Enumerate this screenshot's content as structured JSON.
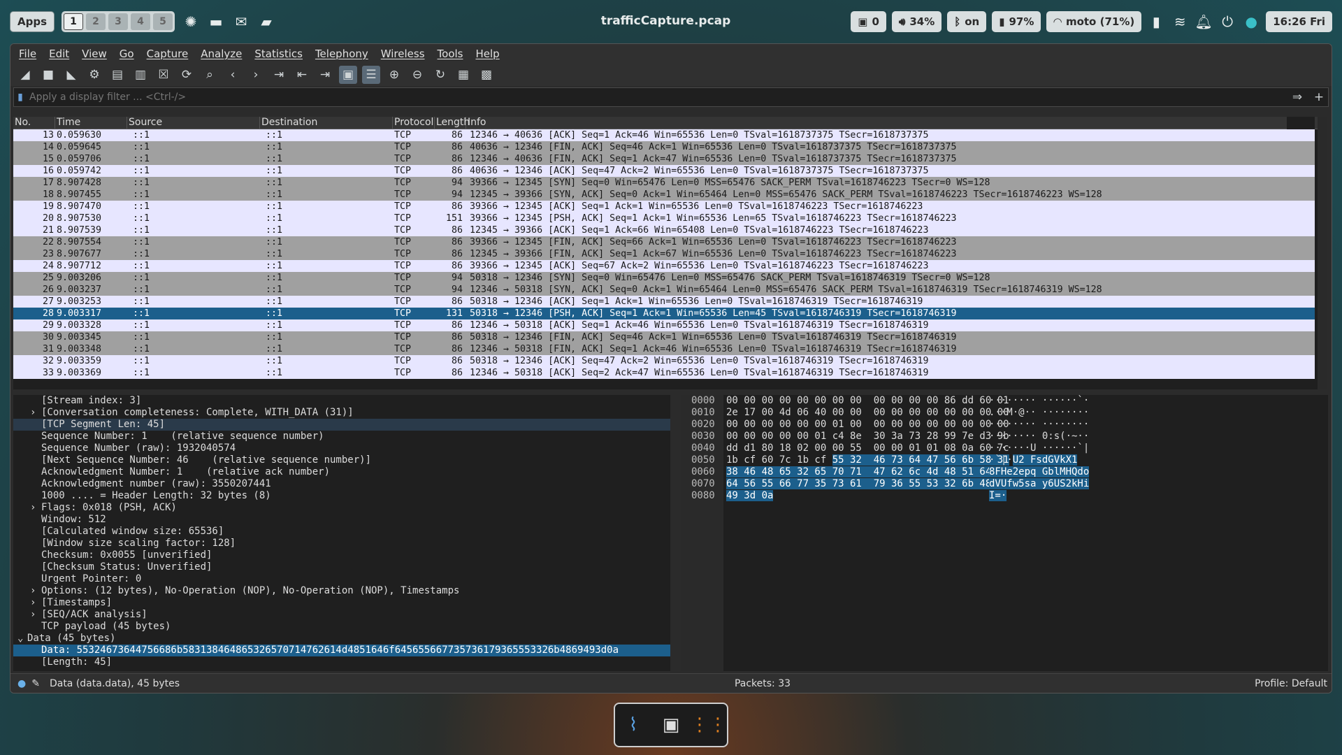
{
  "topbar": {
    "apps_label": "Apps",
    "workspaces": [
      "1",
      "2",
      "3",
      "4",
      "5"
    ],
    "window_title": "trafficCapture.pcap",
    "tray": {
      "docker": "0",
      "volume": "34%",
      "bluetooth": "on",
      "battery": "97%",
      "wifi": "moto (71%)",
      "clock": "16:26 Fri"
    }
  },
  "menu": [
    "File",
    "Edit",
    "View",
    "Go",
    "Capture",
    "Analyze",
    "Statistics",
    "Telephony",
    "Wireless",
    "Tools",
    "Help"
  ],
  "filter": {
    "placeholder": "Apply a display filter ... <Ctrl-/>"
  },
  "columns": [
    "No.",
    "Time",
    "Source",
    "Destination",
    "Protocol",
    "Length",
    "Info"
  ],
  "packets": [
    {
      "no": "13",
      "time": "0.059630",
      "src": "::1",
      "dst": "::1",
      "proto": "TCP",
      "len": "86",
      "info": "12346 → 40636 [ACK] Seq=1 Ack=46 Win=65536 Len=0 TSval=1618737375 TSecr=1618737375",
      "style": "ack"
    },
    {
      "no": "14",
      "time": "0.059645",
      "src": "::1",
      "dst": "::1",
      "proto": "TCP",
      "len": "86",
      "info": "40636 → 12346 [FIN, ACK] Seq=46 Ack=1 Win=65536 Len=0 TSval=1618737375 TSecr=1618737375",
      "style": "fin"
    },
    {
      "no": "15",
      "time": "0.059706",
      "src": "::1",
      "dst": "::1",
      "proto": "TCP",
      "len": "86",
      "info": "12346 → 40636 [FIN, ACK] Seq=1 Ack=47 Win=65536 Len=0 TSval=1618737375 TSecr=1618737375",
      "style": "fin"
    },
    {
      "no": "16",
      "time": "0.059742",
      "src": "::1",
      "dst": "::1",
      "proto": "TCP",
      "len": "86",
      "info": "40636 → 12346 [ACK] Seq=47 Ack=2 Win=65536 Len=0 TSval=1618737375 TSecr=1618737375",
      "style": "ack"
    },
    {
      "no": "17",
      "time": "8.907428",
      "src": "::1",
      "dst": "::1",
      "proto": "TCP",
      "len": "94",
      "info": "39366 → 12345 [SYN] Seq=0 Win=65476 Len=0 MSS=65476 SACK_PERM TSval=1618746223 TSecr=0 WS=128",
      "style": "fin"
    },
    {
      "no": "18",
      "time": "8.907455",
      "src": "::1",
      "dst": "::1",
      "proto": "TCP",
      "len": "94",
      "info": "12345 → 39366 [SYN, ACK] Seq=0 Ack=1 Win=65464 Len=0 MSS=65476 SACK_PERM TSval=1618746223 TSecr=1618746223 WS=128",
      "style": "fin"
    },
    {
      "no": "19",
      "time": "8.907470",
      "src": "::1",
      "dst": "::1",
      "proto": "TCP",
      "len": "86",
      "info": "39366 → 12345 [ACK] Seq=1 Ack=1 Win=65536 Len=0 TSval=1618746223 TSecr=1618746223",
      "style": "ack"
    },
    {
      "no": "20",
      "time": "8.907530",
      "src": "::1",
      "dst": "::1",
      "proto": "TCP",
      "len": "151",
      "info": "39366 → 12345 [PSH, ACK] Seq=1 Ack=1 Win=65536 Len=65 TSval=1618746223 TSecr=1618746223",
      "style": "ack"
    },
    {
      "no": "21",
      "time": "8.907539",
      "src": "::1",
      "dst": "::1",
      "proto": "TCP",
      "len": "86",
      "info": "12345 → 39366 [ACK] Seq=1 Ack=66 Win=65408 Len=0 TSval=1618746223 TSecr=1618746223",
      "style": "ack"
    },
    {
      "no": "22",
      "time": "8.907554",
      "src": "::1",
      "dst": "::1",
      "proto": "TCP",
      "len": "86",
      "info": "39366 → 12345 [FIN, ACK] Seq=66 Ack=1 Win=65536 Len=0 TSval=1618746223 TSecr=1618746223",
      "style": "fin"
    },
    {
      "no": "23",
      "time": "8.907677",
      "src": "::1",
      "dst": "::1",
      "proto": "TCP",
      "len": "86",
      "info": "12345 → 39366 [FIN, ACK] Seq=1 Ack=67 Win=65536 Len=0 TSval=1618746223 TSecr=1618746223",
      "style": "fin"
    },
    {
      "no": "24",
      "time": "8.907712",
      "src": "::1",
      "dst": "::1",
      "proto": "TCP",
      "len": "86",
      "info": "39366 → 12345 [ACK] Seq=67 Ack=2 Win=65536 Len=0 TSval=1618746223 TSecr=1618746223",
      "style": "ack"
    },
    {
      "no": "25",
      "time": "9.003206",
      "src": "::1",
      "dst": "::1",
      "proto": "TCP",
      "len": "94",
      "info": "50318 → 12346 [SYN] Seq=0 Win=65476 Len=0 MSS=65476 SACK_PERM TSval=1618746319 TSecr=0 WS=128",
      "style": "fin"
    },
    {
      "no": "26",
      "time": "9.003237",
      "src": "::1",
      "dst": "::1",
      "proto": "TCP",
      "len": "94",
      "info": "12346 → 50318 [SYN, ACK] Seq=0 Ack=1 Win=65464 Len=0 MSS=65476 SACK_PERM TSval=1618746319 TSecr=1618746319 WS=128",
      "style": "fin"
    },
    {
      "no": "27",
      "time": "9.003253",
      "src": "::1",
      "dst": "::1",
      "proto": "TCP",
      "len": "86",
      "info": "50318 → 12346 [ACK] Seq=1 Ack=1 Win=65536 Len=0 TSval=1618746319 TSecr=1618746319",
      "style": "ack"
    },
    {
      "no": "28",
      "time": "9.003317",
      "src": "::1",
      "dst": "::1",
      "proto": "TCP",
      "len": "131",
      "info": "50318 → 12346 [PSH, ACK] Seq=1 Ack=1 Win=65536 Len=45 TSval=1618746319 TSecr=1618746319",
      "style": "sel"
    },
    {
      "no": "29",
      "time": "9.003328",
      "src": "::1",
      "dst": "::1",
      "proto": "TCP",
      "len": "86",
      "info": "12346 → 50318 [ACK] Seq=1 Ack=46 Win=65536 Len=0 TSval=1618746319 TSecr=1618746319",
      "style": "ack"
    },
    {
      "no": "30",
      "time": "9.003345",
      "src": "::1",
      "dst": "::1",
      "proto": "TCP",
      "len": "86",
      "info": "50318 → 12346 [FIN, ACK] Seq=46 Ack=1 Win=65536 Len=0 TSval=1618746319 TSecr=1618746319",
      "style": "fin"
    },
    {
      "no": "31",
      "time": "9.003348",
      "src": "::1",
      "dst": "::1",
      "proto": "TCP",
      "len": "86",
      "info": "12346 → 50318 [FIN, ACK] Seq=1 Ack=46 Win=65536 Len=0 TSval=1618746319 TSecr=1618746319",
      "style": "fin"
    },
    {
      "no": "32",
      "time": "9.003359",
      "src": "::1",
      "dst": "::1",
      "proto": "TCP",
      "len": "86",
      "info": "50318 → 12346 [ACK] Seq=47 Ack=2 Win=65536 Len=0 TSval=1618746319 TSecr=1618746319",
      "style": "ack"
    },
    {
      "no": "33",
      "time": "9.003369",
      "src": "::1",
      "dst": "::1",
      "proto": "TCP",
      "len": "86",
      "info": "12346 → 50318 [ACK] Seq=2 Ack=47 Win=65536 Len=0 TSval=1618746319 TSecr=1618746319",
      "style": "ack"
    }
  ],
  "details": [
    {
      "text": "[Stream index: 3]",
      "indent": 1
    },
    {
      "text": "[Conversation completeness: Complete, WITH_DATA (31)]",
      "indent": 1,
      "exp": true
    },
    {
      "text": "[TCP Segment Len: 45]",
      "indent": 1,
      "hl": true
    },
    {
      "text": "Sequence Number: 1    (relative sequence number)",
      "indent": 1
    },
    {
      "text": "Sequence Number (raw): 1932040574",
      "indent": 1
    },
    {
      "text": "[Next Sequence Number: 46    (relative sequence number)]",
      "indent": 1
    },
    {
      "text": "Acknowledgment Number: 1    (relative ack number)",
      "indent": 1
    },
    {
      "text": "Acknowledgment number (raw): 3550207441",
      "indent": 1
    },
    {
      "text": "1000 .... = Header Length: 32 bytes (8)",
      "indent": 1
    },
    {
      "text": "Flags: 0x018 (PSH, ACK)",
      "indent": 1,
      "exp": true
    },
    {
      "text": "Window: 512",
      "indent": 1
    },
    {
      "text": "[Calculated window size: 65536]",
      "indent": 1
    },
    {
      "text": "[Window size scaling factor: 128]",
      "indent": 1
    },
    {
      "text": "Checksum: 0x0055 [unverified]",
      "indent": 1
    },
    {
      "text": "[Checksum Status: Unverified]",
      "indent": 1
    },
    {
      "text": "Urgent Pointer: 0",
      "indent": 1
    },
    {
      "text": "Options: (12 bytes), No-Operation (NOP), No-Operation (NOP), Timestamps",
      "indent": 1,
      "exp": true
    },
    {
      "text": "[Timestamps]",
      "indent": 1,
      "exp": true
    },
    {
      "text": "[SEQ/ACK analysis]",
      "indent": 1,
      "exp": true
    },
    {
      "text": "TCP payload (45 bytes)",
      "indent": 1
    },
    {
      "text": "Data (45 bytes)",
      "indent": 0,
      "open": true
    },
    {
      "text": "Data: 55324673644756686b583138464865326570714762614d4851646f645655667735736179365553326b4869493d0a",
      "indent": 1,
      "sel": true
    },
    {
      "text": "[Length: 45]",
      "indent": 1
    }
  ],
  "bytes": [
    {
      "off": "0000",
      "hex": "00 00 00 00 00 00 00 00  00 00 00 00 86 dd 60 01",
      "asc": "········ ······`·",
      "hl_from": -1
    },
    {
      "off": "0010",
      "hex": "2e 17 00 4d 06 40 00 00  00 00 00 00 00 00 00 00",
      "asc": ".··M·@·· ········",
      "hl_from": -1
    },
    {
      "off": "0020",
      "hex": "00 00 00 00 00 00 01 00  00 00 00 00 00 00 00 00",
      "asc": "········ ········",
      "hl_from": -1
    },
    {
      "off": "0030",
      "hex": "00 00 00 00 00 01 c4 8e  30 3a 73 28 99 7e d3 9b",
      "asc": "········ 0:s(·~··",
      "hl_from": -1
    },
    {
      "off": "0040",
      "hex": "dd d1 80 18 02 00 00 55  00 00 01 01 08 0a 60 7c",
      "asc": "·······U ······`|",
      "hl_from": -1
    },
    {
      "off": "0050",
      "hex_pre": "1b cf 60 7c 1b cf ",
      "hex_hl": "55 32  46 73 64 47 56 6b 58 31",
      "asc_pre": "·`|·",
      "asc_hl": "U2 FsdGVkX1"
    },
    {
      "off": "0060",
      "hex_pre": "",
      "hex_hl": "38 46 48 65 32 65 70 71  47 62 6c 4d 48 51 64 6f",
      "asc_pre": "",
      "asc_hl": "8FHe2epq GblMHQdo"
    },
    {
      "off": "0070",
      "hex_pre": "",
      "hex_hl": "64 56 55 66 77 35 73 61  79 36 55 53 32 6b 48 69",
      "asc_pre": "",
      "asc_hl": "dVUfw5sa y6US2kHi"
    },
    {
      "off": "0080",
      "hex_pre": "",
      "hex_hl": "49 3d 0a",
      "asc_pre": "",
      "asc_hl": "I=·"
    }
  ],
  "status": {
    "left": "Data (data.data), 45 bytes",
    "packets": "Packets: 33",
    "profile": "Profile: Default"
  }
}
